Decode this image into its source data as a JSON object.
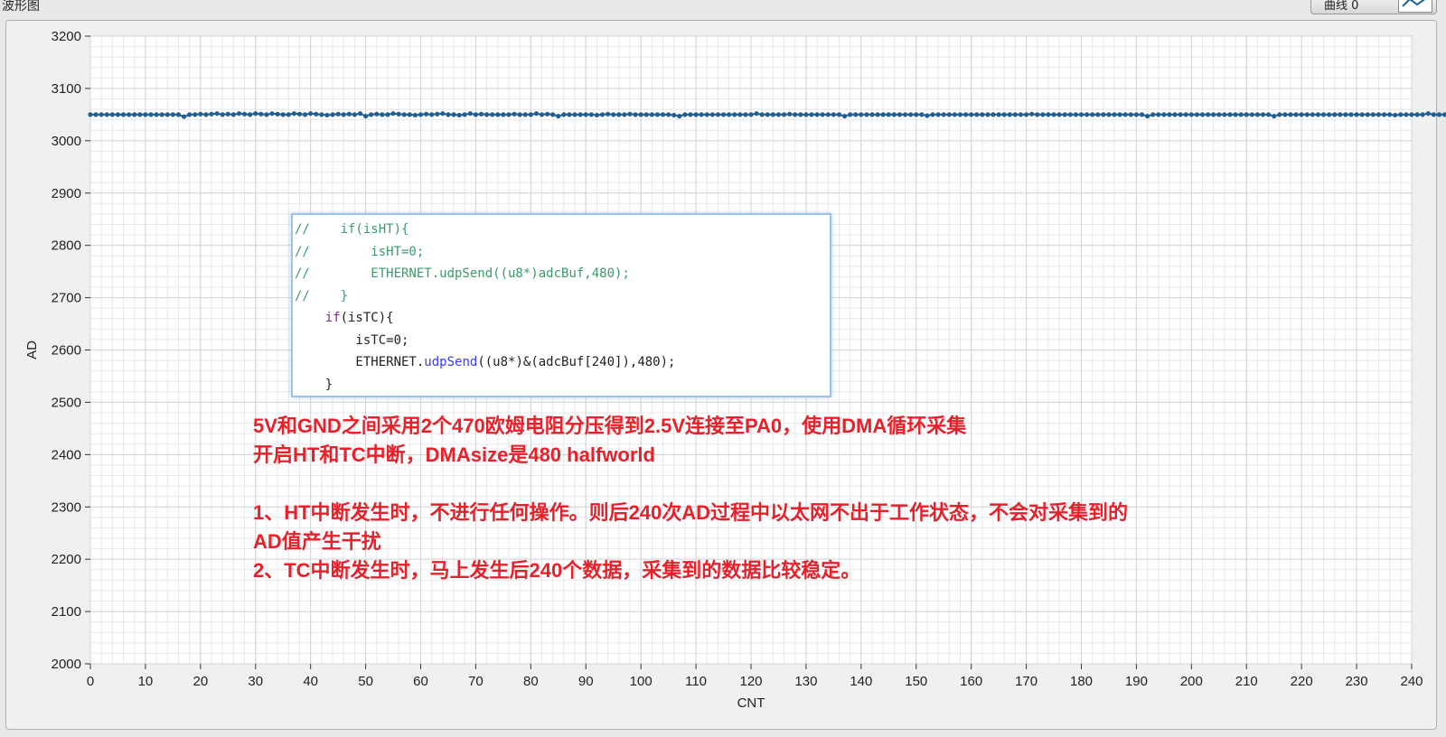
{
  "window": {
    "title": "波形图",
    "legend_label": "曲线 0"
  },
  "colors": {
    "series": "#1f5f96",
    "annotation": "#e8202a",
    "grid_major": "#d4d4d4",
    "grid_minor": "#e8e8e8"
  },
  "code_snippet": [
    {
      "parts": [
        {
          "cls": "c-comment",
          "text": "//    if(isHT){"
        }
      ]
    },
    {
      "parts": [
        {
          "cls": "c-comment",
          "text": "//        isHT=0;"
        }
      ]
    },
    {
      "parts": [
        {
          "cls": "c-comment",
          "text": "//        ETHERNET.udpSend((u8*)adcBuf,480);"
        }
      ]
    },
    {
      "parts": [
        {
          "cls": "c-comment",
          "text": "//    }"
        }
      ]
    },
    {
      "parts": [
        {
          "cls": "c-plain",
          "text": "    "
        },
        {
          "cls": "c-kw",
          "text": "if"
        },
        {
          "cls": "c-plain",
          "text": "(isTC){"
        }
      ]
    },
    {
      "parts": [
        {
          "cls": "c-plain",
          "text": "        isTC=0;"
        }
      ]
    },
    {
      "parts": [
        {
          "cls": "c-plain",
          "text": "        ETHERNET."
        },
        {
          "cls": "c-fn",
          "text": "udpSend"
        },
        {
          "cls": "c-plain",
          "text": "((u8*)&(adcBuf[240]),480);"
        }
      ]
    },
    {
      "parts": [
        {
          "cls": "c-plain",
          "text": "    }"
        }
      ]
    }
  ],
  "annotation": [
    "5V和GND之间采用2个470欧姆电阻分压得到2.5V连接至PA0，使用DMA循环采集",
    "开启HT和TC中断，DMAsize是480 halfworld",
    "",
    "1、HT中断发生时，不进行任何操作。则后240次AD过程中以太网不出于工作状态，不会对采集到的",
    "AD值产生干扰",
    "2、TC中断发生时，马上发生后240个数据，采集到的数据比较稳定。"
  ],
  "chart_data": {
    "type": "line",
    "title": "",
    "xlabel": "CNT",
    "ylabel": "AD",
    "xlim": [
      0,
      240
    ],
    "ylim": [
      2000,
      3200
    ],
    "x_ticks": [
      0,
      10,
      20,
      30,
      40,
      50,
      60,
      70,
      80,
      90,
      100,
      110,
      120,
      130,
      140,
      150,
      160,
      170,
      180,
      190,
      200,
      210,
      220,
      230,
      240
    ],
    "y_ticks": [
      2000,
      2100,
      2200,
      2300,
      2400,
      2500,
      2600,
      2700,
      2800,
      2900,
      3000,
      3100,
      3200
    ],
    "grid": true,
    "markers": true,
    "series": [
      {
        "name": "曲线 0",
        "x_start": 0,
        "x_step": 1,
        "values": [
          3050,
          3050,
          3050,
          3050,
          3050,
          3050,
          3050,
          3050,
          3050,
          3050,
          3050,
          3050,
          3050,
          3050,
          3050,
          3050,
          3050,
          3046,
          3050,
          3050,
          3051,
          3050,
          3051,
          3052,
          3050,
          3051,
          3050,
          3052,
          3051,
          3050,
          3052,
          3051,
          3050,
          3052,
          3051,
          3050,
          3050,
          3052,
          3051,
          3050,
          3052,
          3051,
          3050,
          3049,
          3050,
          3051,
          3050,
          3051,
          3050,
          3052,
          3047,
          3050,
          3051,
          3050,
          3050,
          3052,
          3051,
          3050,
          3050,
          3049,
          3050,
          3051,
          3050,
          3051,
          3052,
          3050,
          3050,
          3049,
          3050,
          3052,
          3050,
          3051,
          3050,
          3050,
          3050,
          3050,
          3050,
          3051,
          3050,
          3050,
          3050,
          3052,
          3050,
          3051,
          3050,
          3047,
          3050,
          3050,
          3050,
          3050,
          3050,
          3050,
          3049,
          3050,
          3051,
          3050,
          3050,
          3050,
          3051,
          3050,
          3050,
          3050,
          3050,
          3050,
          3050,
          3050,
          3049,
          3047,
          3050,
          3050,
          3050,
          3050,
          3050,
          3050,
          3050,
          3050,
          3050,
          3050,
          3050,
          3050,
          3050,
          3052,
          3050,
          3050,
          3050,
          3050,
          3050,
          3051,
          3050,
          3050,
          3050,
          3050,
          3050,
          3050,
          3050,
          3050,
          3050,
          3047,
          3050,
          3050,
          3050,
          3050,
          3050,
          3050,
          3050,
          3050,
          3050,
          3050,
          3050,
          3050,
          3050,
          3050,
          3048,
          3050,
          3050,
          3050,
          3050,
          3050,
          3050,
          3050,
          3050,
          3050,
          3050,
          3050,
          3050,
          3050,
          3050,
          3050,
          3050,
          3050,
          3050,
          3051,
          3050,
          3050,
          3050,
          3050,
          3050,
          3050,
          3050,
          3050,
          3050,
          3050,
          3050,
          3050,
          3050,
          3050,
          3050,
          3050,
          3050,
          3050,
          3050,
          3050,
          3047,
          3050,
          3050,
          3050,
          3050,
          3050,
          3050,
          3050,
          3050,
          3050,
          3050,
          3050,
          3050,
          3050,
          3050,
          3050,
          3050,
          3050,
          3050,
          3050,
          3050,
          3050,
          3050,
          3047,
          3050,
          3050,
          3050,
          3050,
          3050,
          3050,
          3050,
          3050,
          3050,
          3050,
          3050,
          3050,
          3050,
          3050,
          3050,
          3050,
          3050,
          3050,
          3050,
          3050,
          3050,
          3049,
          3050,
          3050,
          3050,
          3050,
          3050,
          3052,
          3050,
          3050,
          3050,
          3050,
          3050,
          3050,
          3050,
          3050,
          3050,
          3050
        ]
      }
    ]
  }
}
